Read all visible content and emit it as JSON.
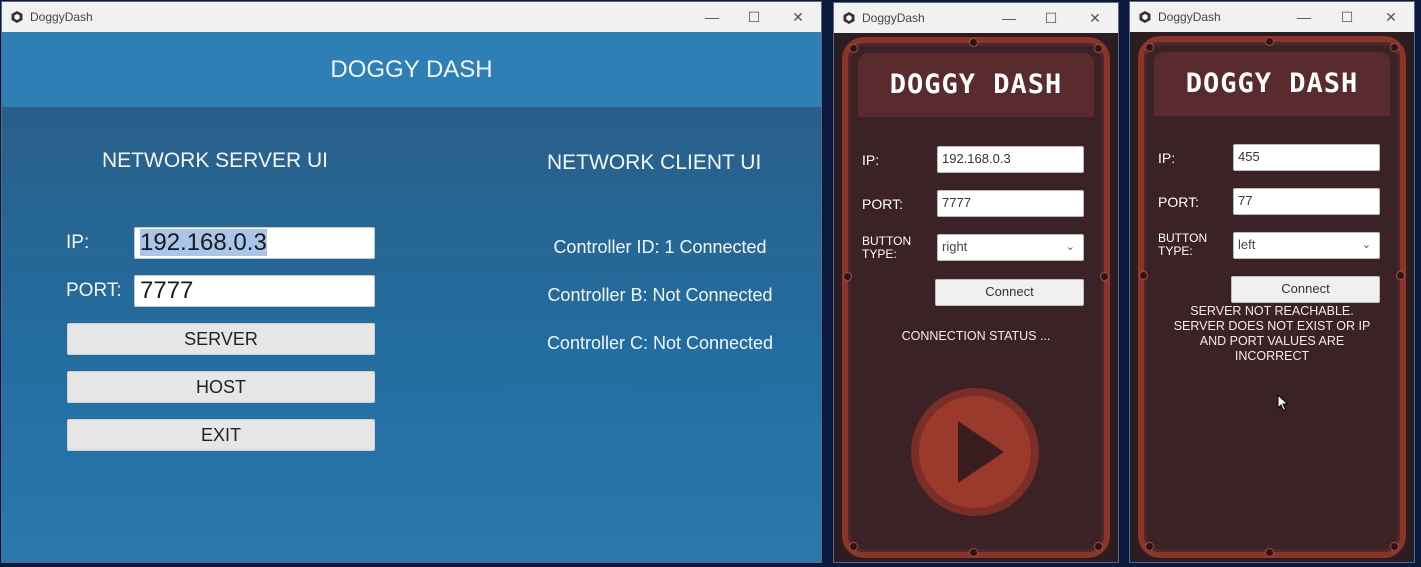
{
  "windows": {
    "server": {
      "title": "DoggyDash",
      "banner": "DOGGY DASH",
      "server_heading": "NETWORK SERVER UI",
      "client_heading": "NETWORK CLIENT UI",
      "ip_label": "IP:",
      "ip_value": "192.168.0.3",
      "port_label": "PORT:",
      "port_value": "7777",
      "buttons": {
        "server": "SERVER",
        "host": "HOST",
        "exit": "EXIT"
      },
      "controllers": [
        "Controller ID: 1 Connected",
        "Controller B: Not Connected",
        "Controller C: Not Connected"
      ]
    },
    "client_a": {
      "title": "DoggyDash",
      "game_title": "DOGGY DASH",
      "ip_label": "IP:",
      "ip_value": "192.168.0.3",
      "port_label": "PORT:",
      "port_value": "7777",
      "button_type_label_1": "BUTTON",
      "button_type_label_2": "TYPE:",
      "button_type_value": "right",
      "connect_label": "Connect",
      "status": "CONNECTION STATUS ..."
    },
    "client_b": {
      "title": "DoggyDash",
      "game_title": "DOGGY DASH",
      "ip_label": "IP:",
      "ip_value": "455",
      "port_label": "PORT:",
      "port_value": "77",
      "button_type_label_1": "BUTTON",
      "button_type_label_2": "TYPE:",
      "button_type_value": "left",
      "connect_label": "Connect",
      "status_lines": [
        "SERVER NOT REACHABLE.",
        "SERVER DOES NOT EXIST OR IP",
        "AND PORT VALUES ARE",
        "INCORRECT"
      ]
    }
  },
  "window_controls": {
    "minimize": "—",
    "maximize": "☐",
    "close": "✕"
  },
  "colors": {
    "server_bg": "#236da0",
    "banner": "#2e7fb6",
    "client_frame": "#8b3428",
    "client_panel": "#3b2227",
    "play_button": "#9b3a2c"
  },
  "icons": {
    "app": "unity-icon",
    "play": "play-icon",
    "cursor": "mouse-cursor-icon"
  }
}
